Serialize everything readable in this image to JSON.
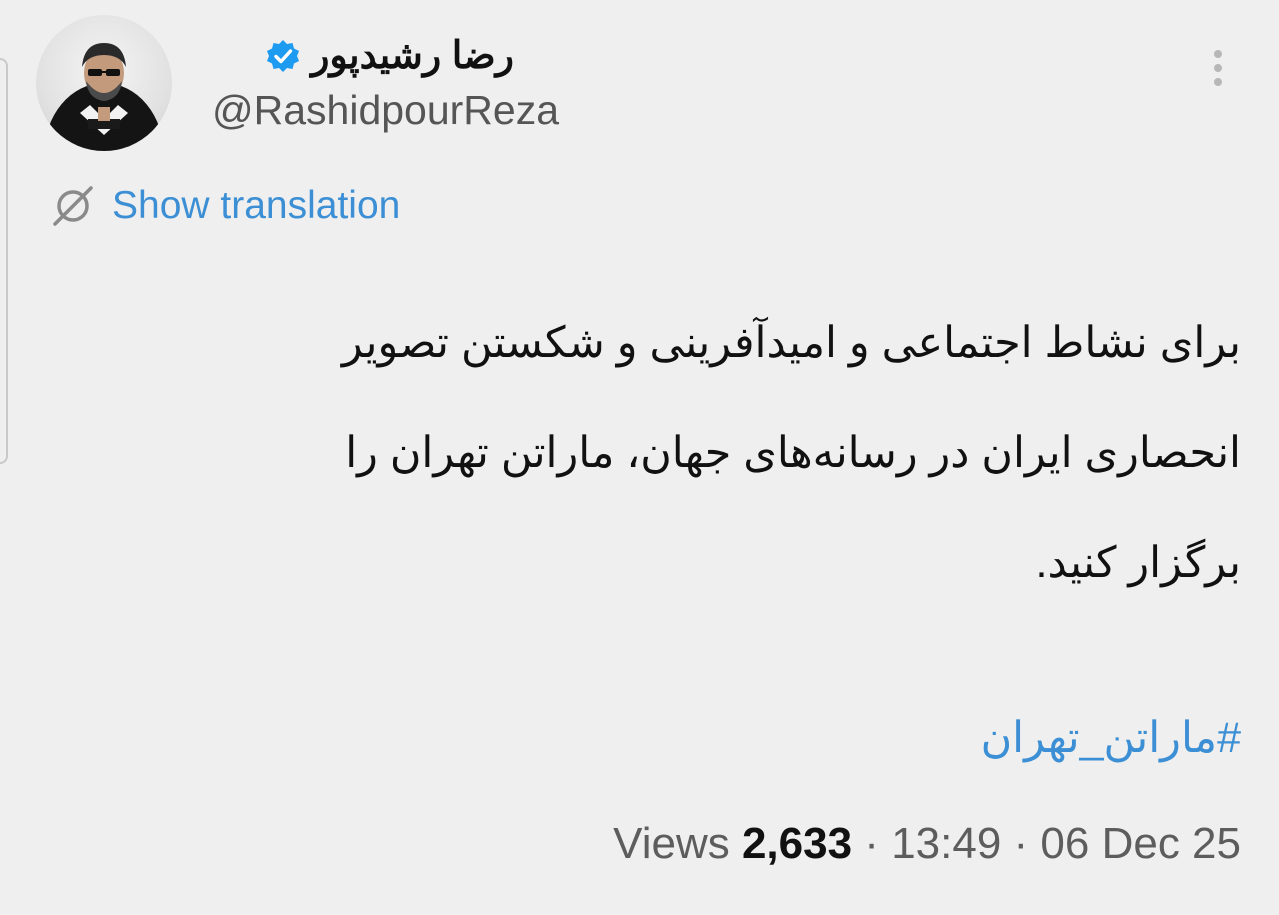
{
  "author": {
    "display_name": "رضا رشیدپور",
    "handle": "@RashidpourReza",
    "verified_color": "#1d9bf0"
  },
  "translation": {
    "label": "Show translation",
    "icon": "globe-slash-icon"
  },
  "tweet": {
    "lines": [
      "برای نشاط اجتماعی و امیدآفرینی و شکستن تصویر",
      "انحصاری ایران در رسانه‌های جهان، ماراتن تهران را",
      "برگزار کنید."
    ],
    "hashtag": "#ماراتن_تهران"
  },
  "meta": {
    "views_label": "Views",
    "views_count": "2,633",
    "separator": "·",
    "time": "13:49",
    "date": "06 Dec 25"
  },
  "colors": {
    "link": "#3c8fd4",
    "background": "#efefef"
  }
}
